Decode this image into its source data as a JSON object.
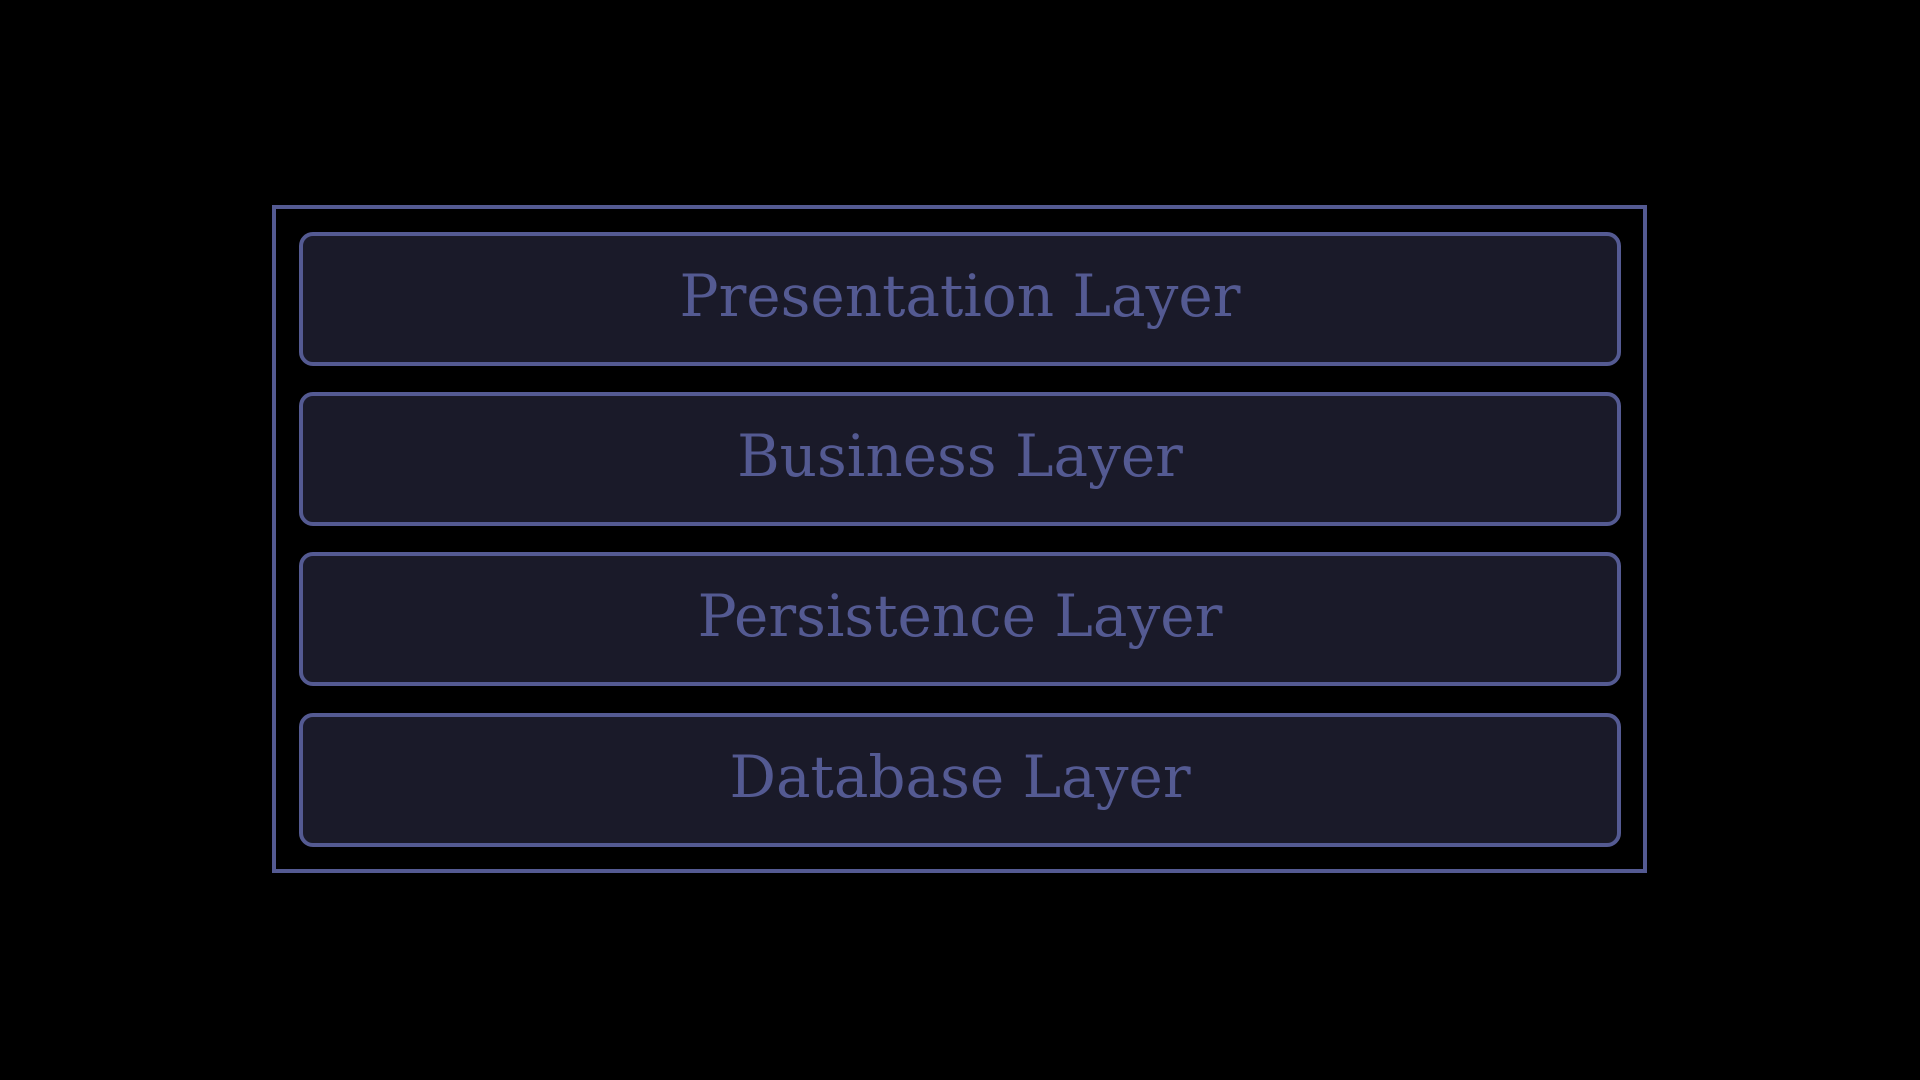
{
  "colors": {
    "background": "#000000",
    "stroke": "#545a92",
    "fill": "#1a1a29",
    "text": "#545a92"
  },
  "diagram": {
    "layers": [
      {
        "label": "Presentation Layer"
      },
      {
        "label": "Business Layer"
      },
      {
        "label": "Persistence Layer"
      },
      {
        "label": "Database Layer"
      }
    ]
  }
}
